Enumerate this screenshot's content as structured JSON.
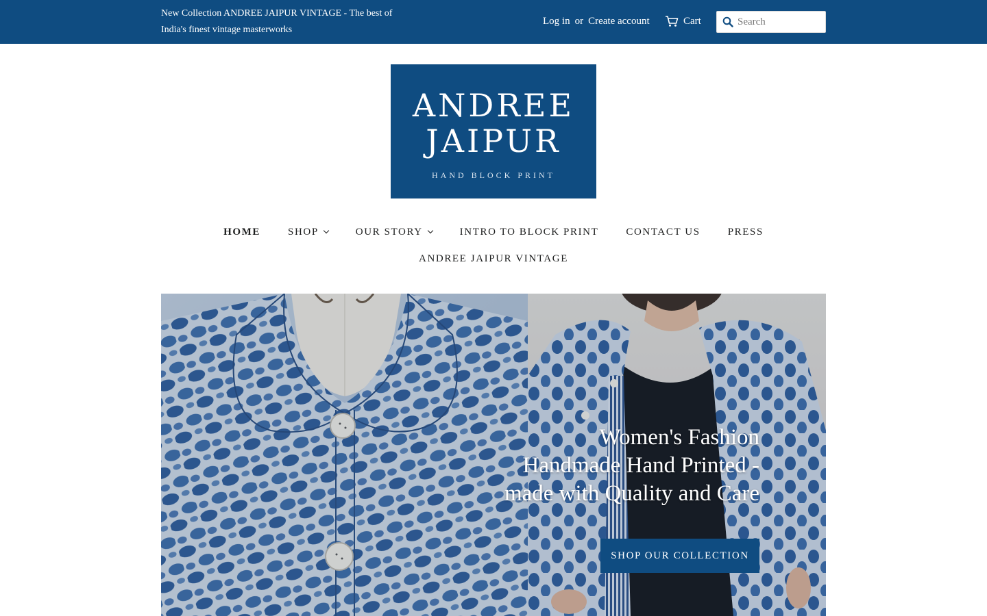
{
  "header": {
    "announcement": "New Collection ANDREE JAIPUR VINTAGE - The best of India's finest vintage masterworks",
    "login_label": "Log in",
    "or_label": "or",
    "create_account_label": "Create account",
    "cart_label": "Cart",
    "search": {
      "placeholder": "Search",
      "value": ""
    }
  },
  "logo": {
    "line1": "ANDREE",
    "line2": "JAIPUR",
    "tagline": "HAND BLOCK PRINT"
  },
  "nav": {
    "row1": [
      {
        "label": "HOME",
        "active": true,
        "dropdown": false
      },
      {
        "label": "SHOP",
        "active": false,
        "dropdown": true
      },
      {
        "label": "OUR STORY",
        "active": false,
        "dropdown": true
      },
      {
        "label": "INTRO TO BLOCK PRINT",
        "active": false,
        "dropdown": false
      },
      {
        "label": "CONTACT US",
        "active": false,
        "dropdown": false
      },
      {
        "label": "PRESS",
        "active": false,
        "dropdown": false
      }
    ],
    "row2": [
      {
        "label": "ANDREE JAIPUR VINTAGE",
        "active": false,
        "dropdown": false
      }
    ]
  },
  "hero": {
    "headline_line1": "Women's Fashion",
    "headline_line2": "Handmade Hand Printed -",
    "headline_line3": "made with Quality and Care",
    "button_label": "SHOP OUR COLLECTION"
  },
  "colors": {
    "brand": "#0f4c81",
    "text": "#1c1d1d",
    "background": "#ffffff"
  }
}
